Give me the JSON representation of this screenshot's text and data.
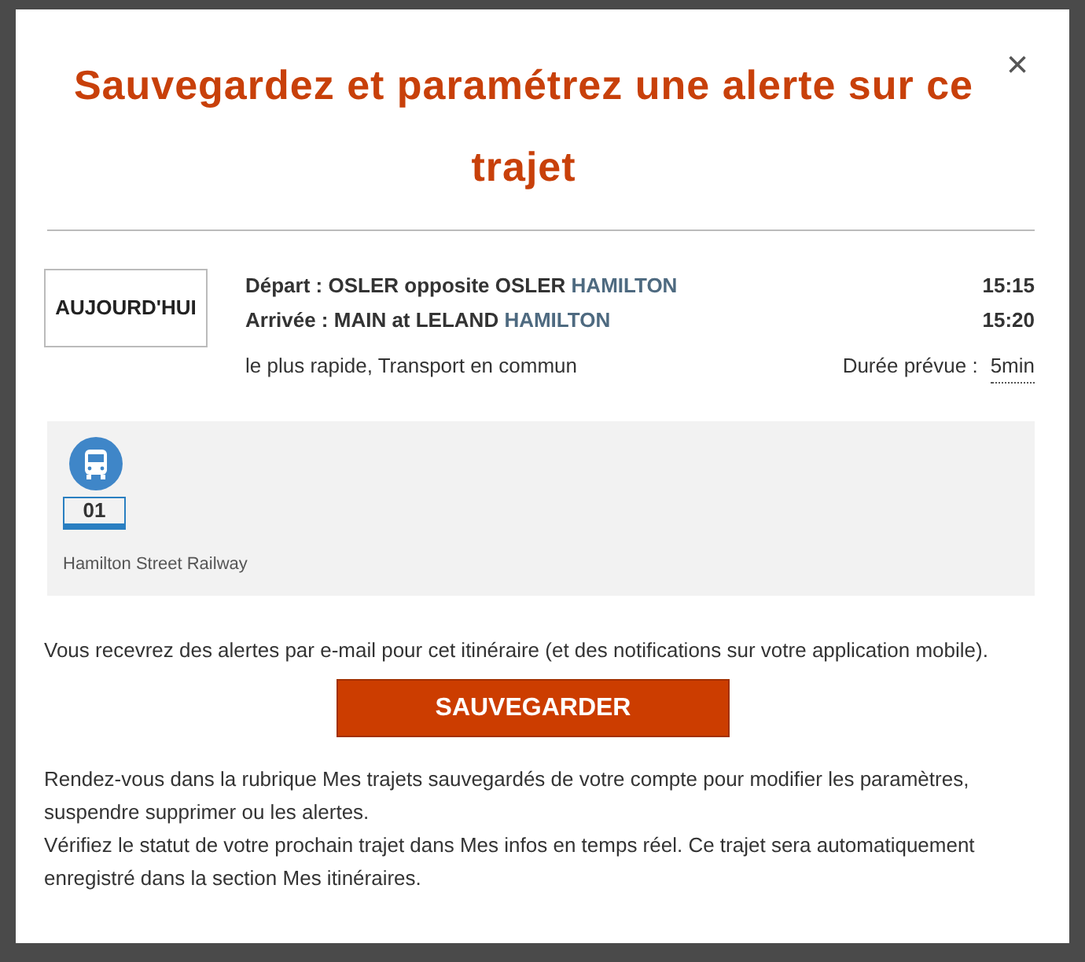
{
  "modal": {
    "title": "Sauvegardez et paramétrez une alerte sur ce trajet",
    "close": "×"
  },
  "trip": {
    "day": "AUJOURD'HUI",
    "stops": [
      {
        "label": "Départ :",
        "stop": "OSLER opposite OSLER",
        "city": "HAMILTON",
        "time": "15:15"
      },
      {
        "label": "Arrivée :",
        "stop": "MAIN at LELAND",
        "city": "HAMILTON",
        "time": "15:20"
      }
    ],
    "summary": "le plus rapide, Transport en commun",
    "duration_label": "Durée prévue :",
    "duration": "5min"
  },
  "legs": [
    {
      "kind": "bus",
      "line": "01",
      "operator": "Hamilton Street Railway"
    }
  ],
  "notice": "Vous recevrez des alertes par e-mail pour cet itinéraire (et des notifications sur votre application mobile).",
  "save_button": "SAUVEGARDER",
  "info": [
    "Rendez-vous dans la rubrique Mes trajets sauvegardés de votre compte pour modifier les paramètres, suspendre supprimer ou les alertes.",
    "Vérifiez le statut de votre prochain trajet dans Mes infos en temps réel. Ce trajet sera automatiquement enregistré dans la section Mes itinéraires."
  ]
}
